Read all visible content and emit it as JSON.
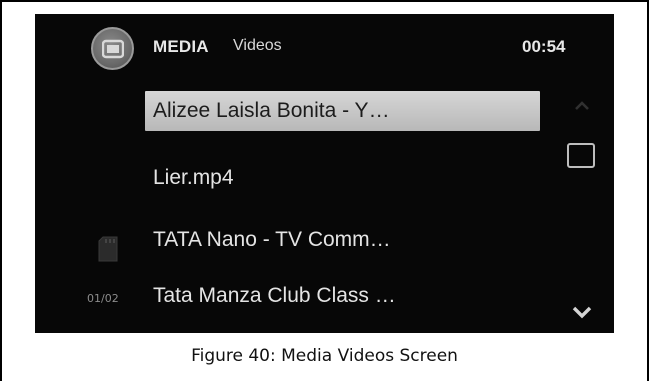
{
  "header": {
    "title": "MEDIA",
    "subtitle": "Videos",
    "time": "00:54"
  },
  "icons": {
    "media": "media-icon",
    "sd_card": "sd-card-icon",
    "scroll_up": "chevron-up-icon",
    "scroll_down": "chevron-down-icon"
  },
  "list": {
    "items": [
      {
        "label": "Alizee Laisla Bonita - Y…",
        "selected": true
      },
      {
        "label": "Lier.mp4",
        "selected": false
      },
      {
        "label": "TATA Nano - TV Comm…",
        "selected": false
      },
      {
        "label": "Tata Manza Club Class …",
        "selected": false
      }
    ]
  },
  "pagination": {
    "label": "01/02"
  },
  "caption": "Figure 40: Media Videos Screen",
  "colors": {
    "screen_bg": "#070707",
    "selected_bg": "#c8c8c8",
    "text": "#e4e4e4"
  }
}
